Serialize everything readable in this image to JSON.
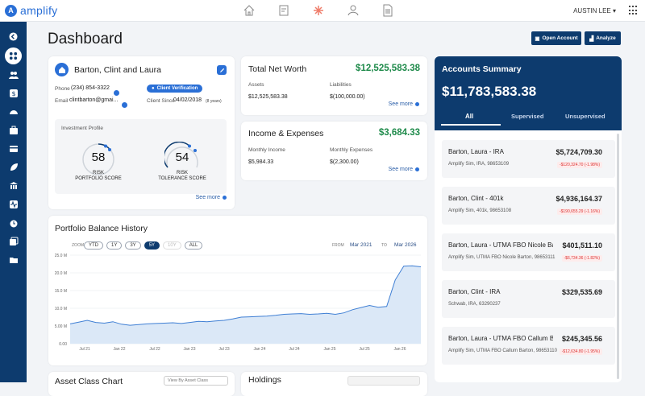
{
  "header": {
    "logo_mark": "A",
    "logo_text": "amplify",
    "user_name": "AUSTIN LEE ▾",
    "nav_icons": [
      "home-icon",
      "document-edit-icon",
      "asterisk-icon",
      "people-icon",
      "list-document-icon"
    ]
  },
  "sidebar": {
    "icons": [
      "back-arrow-icon",
      "apps-grid-icon",
      "users-icon",
      "money-icon",
      "dashboard-gauge-icon",
      "briefcase-icon",
      "card-icon",
      "leaf-icon",
      "bank-icon",
      "pulse-icon",
      "alarm-icon",
      "cards-stack-icon",
      "folder-icon"
    ],
    "active_index": 1
  },
  "page": {
    "title": "Dashboard",
    "open_account_label": "Open Account",
    "analyze_label": "Analyze"
  },
  "client": {
    "name": "Barton, Clint and Laura",
    "phone_label": "Phone",
    "phone": "(234) 854-3322",
    "email_label": "Email",
    "email": "clintbarton@gmai...",
    "verification": "Client Verification",
    "client_since_label": "Client Since",
    "client_since": "04/02/2018",
    "client_since_years": "(8 years)",
    "profile_title": "Investment Profile",
    "risk_portfolio": {
      "value": "58",
      "label1": "RISK",
      "label2": "PORTFOLIO SCORE"
    },
    "risk_tolerance": {
      "value": "54",
      "label1": "RISK",
      "label2": "TOLERANCE SCORE"
    },
    "see_more": "See more"
  },
  "net_worth": {
    "title": "Total Net Worth",
    "value": "$12,525,583.38",
    "assets_label": "Assets",
    "assets": "$12,525,583.38",
    "liabilities_label": "Liabilities",
    "liabilities": "$(100,000.00)",
    "see_more": "See more"
  },
  "income": {
    "title": "Income & Expenses",
    "value": "$3,684.33",
    "monthly_income_label": "Monthly Income",
    "monthly_income": "$5,984.33",
    "monthly_expenses_label": "Monthly Expenses",
    "monthly_expenses": "$(2,300.00)",
    "see_more": "See more"
  },
  "accounts_summary": {
    "title": "Accounts Summary",
    "total": "$11,783,583.38",
    "tabs": [
      "All",
      "Supervised",
      "Unsupervised"
    ],
    "accounts": [
      {
        "name": "Barton, Laura - IRA",
        "amount": "$5,724,709.30",
        "sub": "Amplify Sim, IRA, 98653109",
        "change": "-$120,324.70 (-1.98%)"
      },
      {
        "name": "Barton, Clint - 401k",
        "amount": "$4,936,164.37",
        "sub": "Amplify Sim, 401k, 98653108",
        "change": "-$190,655.29 (-1.16%)"
      },
      {
        "name": "Barton, Laura - UTMA FBO Nicole Bart...",
        "amount": "$401,511.10",
        "sub": "Amplify Sim, UTMA FBO Nicole Barton, 98653111",
        "change": "-$6,734.36 (-1.82%)"
      },
      {
        "name": "Barton, Clint - IRA",
        "amount": "$329,535.69",
        "sub": "Schwab, IRA, 63290237",
        "change": ""
      },
      {
        "name": "Barton, Laura - UTMA FBO Callum Bar...",
        "amount": "$245,345.56",
        "sub": "Amplify Sim, UTMA FBO Callum Barton, 98653110",
        "change": "-$12,634.80 (-1.95%)"
      }
    ]
  },
  "history": {
    "title": "Portfolio Balance History",
    "zoom_label": "ZOOM",
    "zoom_options": [
      "YTD",
      "1Y",
      "3Y",
      "5Y",
      "10Y",
      "ALL"
    ],
    "zoom_selected": "5Y",
    "zoom_disabled": "10Y",
    "from_label": "FROM",
    "from": "Mar 2021",
    "to_label": "TO",
    "to": "Mar 2026"
  },
  "chart_data": {
    "type": "area",
    "yticks": [
      "25.0 M",
      "20.0 M",
      "15.0 M",
      "10.0 M",
      "5.00 M",
      "0.00"
    ],
    "ylim": [
      0,
      25
    ],
    "xticks": [
      "Jul 21",
      "Jan 22",
      "Jul 22",
      "Jan 23",
      "Jul 23",
      "Jan 24",
      "Jul 24",
      "Jan 25",
      "Jul 25",
      "Jan 26"
    ],
    "series": [
      {
        "values": [
          5.6,
          6.1,
          6.6,
          6.0,
          5.8,
          6.2,
          5.5,
          5.2,
          5.4,
          5.6,
          5.7,
          5.8,
          5.9,
          5.7,
          6.0,
          6.3,
          6.2,
          6.4,
          6.6,
          7.0,
          7.5,
          7.6,
          7.7,
          7.8,
          8.0,
          8.3,
          8.4,
          8.5,
          8.3,
          8.4,
          8.6,
          8.3,
          8.7,
          9.6,
          10.2,
          10.8,
          10.3,
          10.5,
          18.0,
          21.9,
          22.0,
          21.7
        ]
      }
    ],
    "colors": {
      "line": "#3f7fd4",
      "fill": "#dbe8f7"
    }
  },
  "bottom": {
    "asset_class_title": "Asset Class Chart",
    "asset_view_label": "View By Asset Class",
    "holdings_title": "Holdings"
  }
}
